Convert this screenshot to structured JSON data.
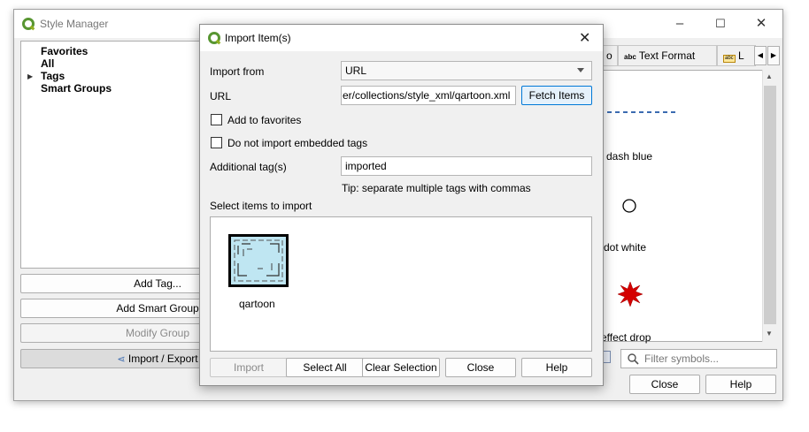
{
  "style_manager": {
    "title": "Style Manager",
    "tree": {
      "favorites": "Favorites",
      "all": "All",
      "tags": "Tags",
      "smart_groups": "Smart Groups"
    },
    "buttons": {
      "add_tag": "Add Tag...",
      "add_smart_group": "Add Smart Group",
      "modify_group": "Modify Group",
      "import_export": "Import / Export"
    },
    "tabs": {
      "partial": "o",
      "text_format": "Text Format",
      "labels_partial": "L"
    },
    "tab_icons": {
      "text_format": "abc",
      "labels": "abc"
    },
    "symbols": [
      "dash blue",
      "dot  white",
      "effect drop"
    ],
    "filter_placeholder": "Filter symbols...",
    "close": "Close",
    "help": "Help",
    "window_controls": {
      "minimize": "–",
      "maximize": "☐",
      "close": "✕"
    }
  },
  "dialog": {
    "title": "Import Item(s)",
    "close_glyph": "✕",
    "import_from_label": "Import from",
    "import_from_value": "URL",
    "url_label": "URL",
    "url_value": "er/collections/style_xml/qartoon.xml",
    "fetch_items": "Fetch Items",
    "add_to_favorites": "Add to favorites",
    "no_embedded_tags": "Do not import embedded tags",
    "additional_tags_label": "Additional tag(s)",
    "additional_tags_value": "imported",
    "tip": "Tip: separate multiple tags with commas",
    "select_items_label": "Select items to import",
    "items": [
      {
        "name": "qartoon",
        "selected": true
      }
    ],
    "buttons": {
      "import": "Import",
      "select_all": "Select All",
      "clear_selection": "Clear Selection",
      "close": "Close",
      "help": "Help"
    }
  },
  "colors": {
    "qgis_green": "#589632",
    "symbol_blue": "#3b6bb0",
    "symbol_red": "#d40000",
    "item_thumb": "#bfe6f2"
  }
}
